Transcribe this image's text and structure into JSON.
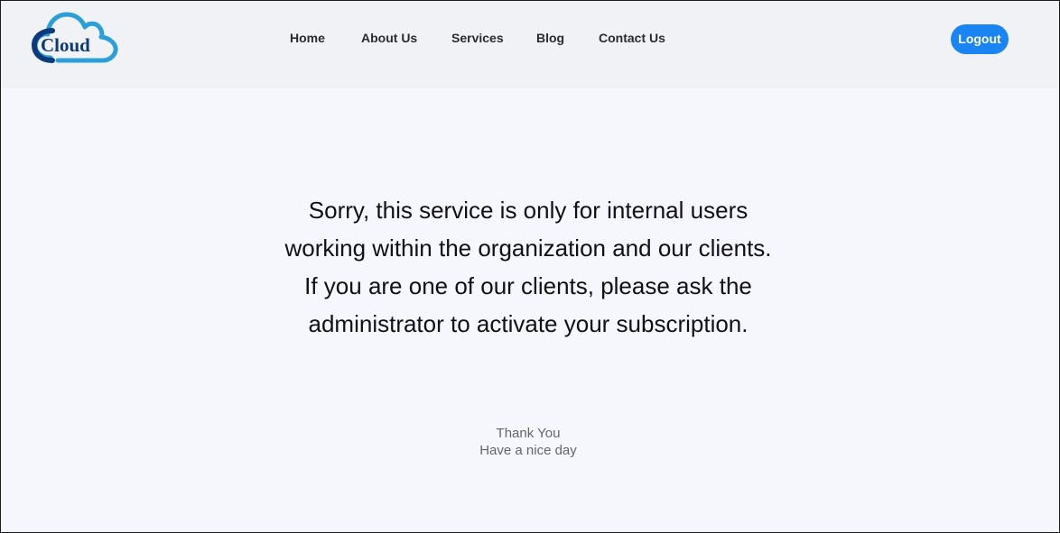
{
  "header": {
    "logo_text": "Cloud",
    "nav": [
      {
        "label": "Home"
      },
      {
        "label": "About Us"
      },
      {
        "label": "Services"
      },
      {
        "label": "Blog"
      },
      {
        "label": "Contact Us"
      }
    ],
    "logout_label": "Logout"
  },
  "main": {
    "message": "Sorry, this service is only for internal users working within the organization and our clients. If you are one of our clients, please ask the administrator to activate your subscription.",
    "thanks_line1": "Thank You",
    "thanks_line2": "Have a nice day"
  },
  "colors": {
    "accent": "#1a84f2",
    "logo_dark": "#0d3a7a",
    "logo_light": "#2a9fd8",
    "header_bg": "#f1f2f6",
    "page_bg": "#f6f7fc"
  }
}
